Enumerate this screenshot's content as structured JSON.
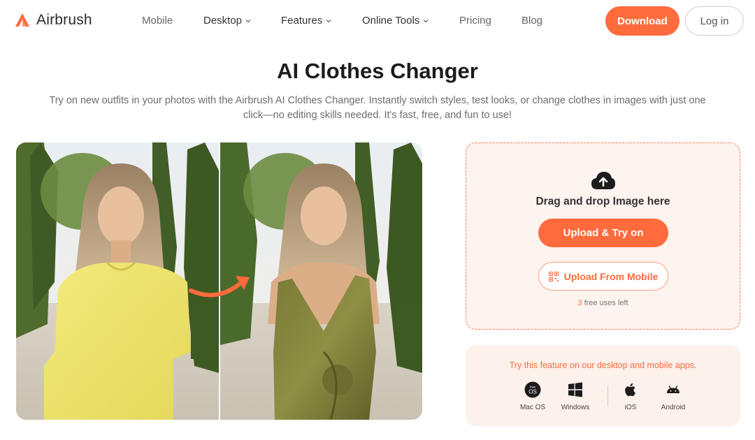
{
  "brand": {
    "name": "Airbrush",
    "accent": "#ff6b3d"
  },
  "nav": {
    "items": [
      {
        "label": "Mobile",
        "dropdown": false
      },
      {
        "label": "Desktop",
        "dropdown": true
      },
      {
        "label": "Features",
        "dropdown": true
      },
      {
        "label": "Online Tools",
        "dropdown": true
      },
      {
        "label": "Pricing",
        "dropdown": false
      },
      {
        "label": "Blog",
        "dropdown": false
      }
    ],
    "download_label": "Download",
    "login_label": "Log in"
  },
  "hero": {
    "title": "AI Clothes Changer",
    "subtitle_line1": "Try on new outfits in your photos with the Airbrush AI Clothes Changer. Instantly switch styles, test looks, or change clothes in images with just one",
    "subtitle_line2": "click—no editing skills needed. It's fast, free, and fun to use!"
  },
  "upload": {
    "drag_text": "Drag and drop Image here",
    "upload_label": "Upload & Try on",
    "mobile_label": "Upload From Mobile",
    "free_count": "3",
    "free_suffix": " free uses left"
  },
  "apps": {
    "prompt": "Try this feature on our desktop and mobile apps.",
    "platforms": [
      {
        "label": "Mac OS",
        "icon": "macos-icon"
      },
      {
        "label": "Windows",
        "icon": "windows-icon"
      },
      {
        "label": "iOS",
        "icon": "apple-icon"
      },
      {
        "label": "Android",
        "icon": "android-icon"
      }
    ]
  }
}
